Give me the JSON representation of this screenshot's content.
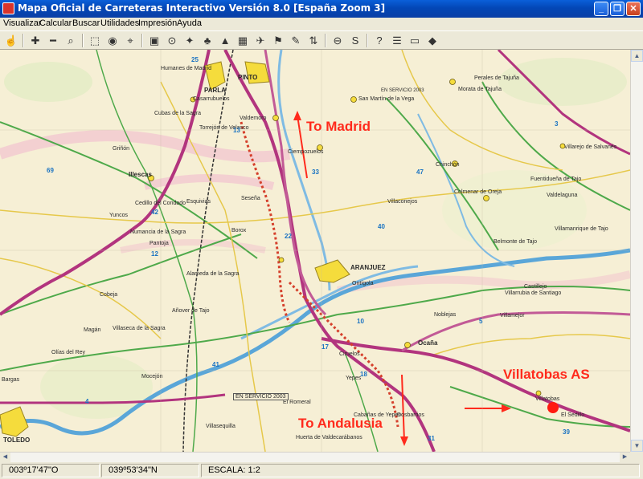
{
  "window": {
    "title": "Mapa Oficial de Carreteras Interactivo Versión 8.0  [España Zoom 3]",
    "minimize": "_",
    "restore": "❐",
    "close": "✕"
  },
  "menu": [
    "Visualizar",
    "Calcular",
    "Buscar",
    "Utilidades",
    "Impresión",
    "Ayuda"
  ],
  "toolbar": {
    "icons": [
      "hand-icon",
      "zoom-in-icon",
      "zoom-out-icon",
      "magnifier-icon",
      "select-tool-icon",
      "globe-icon",
      "find-icon",
      "color-palette-icon",
      "point-icon",
      "location-icon",
      "tree-icon",
      "terrain-icon",
      "factory-icon",
      "plane-icon",
      "flag-icon",
      "pen-icon",
      "route-icon",
      "no-entry-icon",
      "shield-icon",
      "help-icon",
      "list-icon",
      "window-icon",
      "eraser-icon"
    ],
    "glyphs": [
      "☝",
      "✚",
      "━",
      "⌕",
      "⬚",
      "◉",
      "⌖",
      "▣",
      "⊙",
      "✦",
      "♣",
      "▲",
      "▦",
      "✈",
      "⚑",
      "✎",
      "⇅",
      "⊖",
      "S",
      "?",
      "☰",
      "▭",
      "◆"
    ]
  },
  "map": {
    "annotations": [
      {
        "id": "to-madrid",
        "text": "To Madrid"
      },
      {
        "id": "villatobas",
        "text": "Villatobas AS"
      },
      {
        "id": "to-andalusia",
        "text": "To Andalusia"
      }
    ],
    "big_places": [
      "PARLA",
      "PINTO",
      "ARANJUEZ",
      "TOLEDO",
      "Illescas",
      "Ocaña"
    ],
    "places": [
      "Humanes de Madrid",
      "Valdemoro",
      "Ciempozuelos",
      "San Martín de la Vega",
      "Morata de Tajuña",
      "Chinchón",
      "Colmenar de Oreja",
      "Villaconejos",
      "Seseña",
      "Yuncos",
      "Borox",
      "Alameda de la Sagra",
      "Añover de Tajo",
      "Villaseca de la Sagra",
      "Mocejón",
      "Olías del Rey",
      "Noblejas",
      "Villarrubia de Santiago",
      "Dosbarrios",
      "Cabañas de Yepes",
      "Huerta de Valdecarábanos",
      "Villarejo de Salvanés",
      "Fuentidueña de Tajo",
      "Villamanrique de Tajo",
      "Ontígola",
      "Yepes",
      "Villasequilla",
      "Villatobas",
      "El Sedillo",
      "Belmonte de Tajo",
      "Valdelaguna",
      "Perales de Tajuña",
      "Griñón",
      "Cubas de la Sagra",
      "Casarrubuelos",
      "Torrejón de Velasco",
      "Cedillo del Condado",
      "Esquivias",
      "Numancia de la Sagra",
      "Pantoja",
      "Cobeja",
      "Magán",
      "Bargas",
      "Ciruelos",
      "Villamejor",
      "Castillejo",
      "El Romeral"
    ],
    "road_numbers": [
      "25",
      "42",
      "69",
      "13",
      "33",
      "22",
      "31",
      "47",
      "40",
      "41",
      "18",
      "17",
      "10",
      "39",
      "4",
      "3",
      "5",
      "12"
    ],
    "service_labels": [
      "EN SERVICIO 2003",
      "EN SERVICIO 2003"
    ]
  },
  "status": {
    "longitude": "003º17'47\"O",
    "latitude": "039º53'34\"N",
    "scale": "ESCALA: 1:2"
  }
}
